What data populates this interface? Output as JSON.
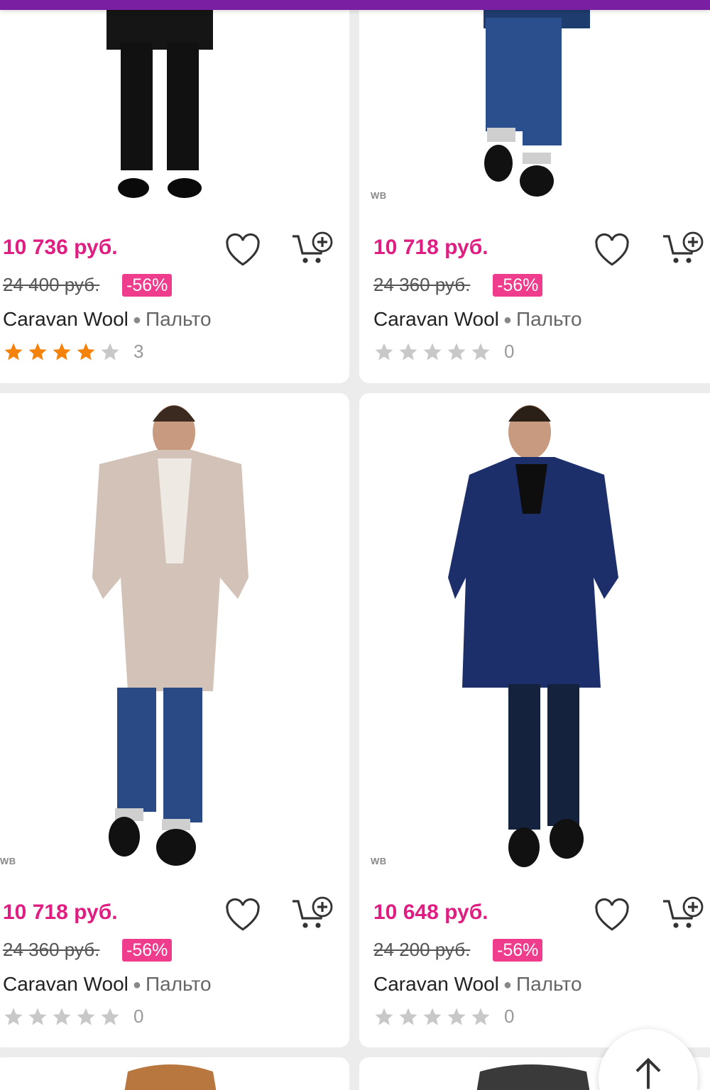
{
  "colors": {
    "accent": "#7a1fa2",
    "price": "#e01e82",
    "discount_bg": "#f03c8c",
    "star_filled": "#f5820b",
    "star_empty": "#c8c8c8"
  },
  "products": [
    {
      "price": "10 736 руб.",
      "old_price": "24 400 руб.",
      "discount": "-56%",
      "brand": "Caravan Wool",
      "category": "Пальто",
      "rating": 4,
      "reviews": "3",
      "watermark": ""
    },
    {
      "price": "10 718 руб.",
      "old_price": "24 360 руб.",
      "discount": "-56%",
      "brand": "Caravan Wool",
      "category": "Пальто",
      "rating": 0,
      "reviews": "0",
      "watermark": "WB"
    },
    {
      "price": "10 718 руб.",
      "old_price": "24 360 руб.",
      "discount": "-56%",
      "brand": "Caravan Wool",
      "category": "Пальто",
      "rating": 0,
      "reviews": "0",
      "watermark": "WB"
    },
    {
      "price": "10 648 руб.",
      "old_price": "24 200 руб.",
      "discount": "-56%",
      "brand": "Caravan Wool",
      "category": "Пальто",
      "rating": 0,
      "reviews": "0",
      "watermark": "WB"
    }
  ],
  "icons": {
    "favorite": "heart-icon",
    "add_to_cart": "cart-plus-icon",
    "scroll_top": "arrow-up-icon"
  }
}
